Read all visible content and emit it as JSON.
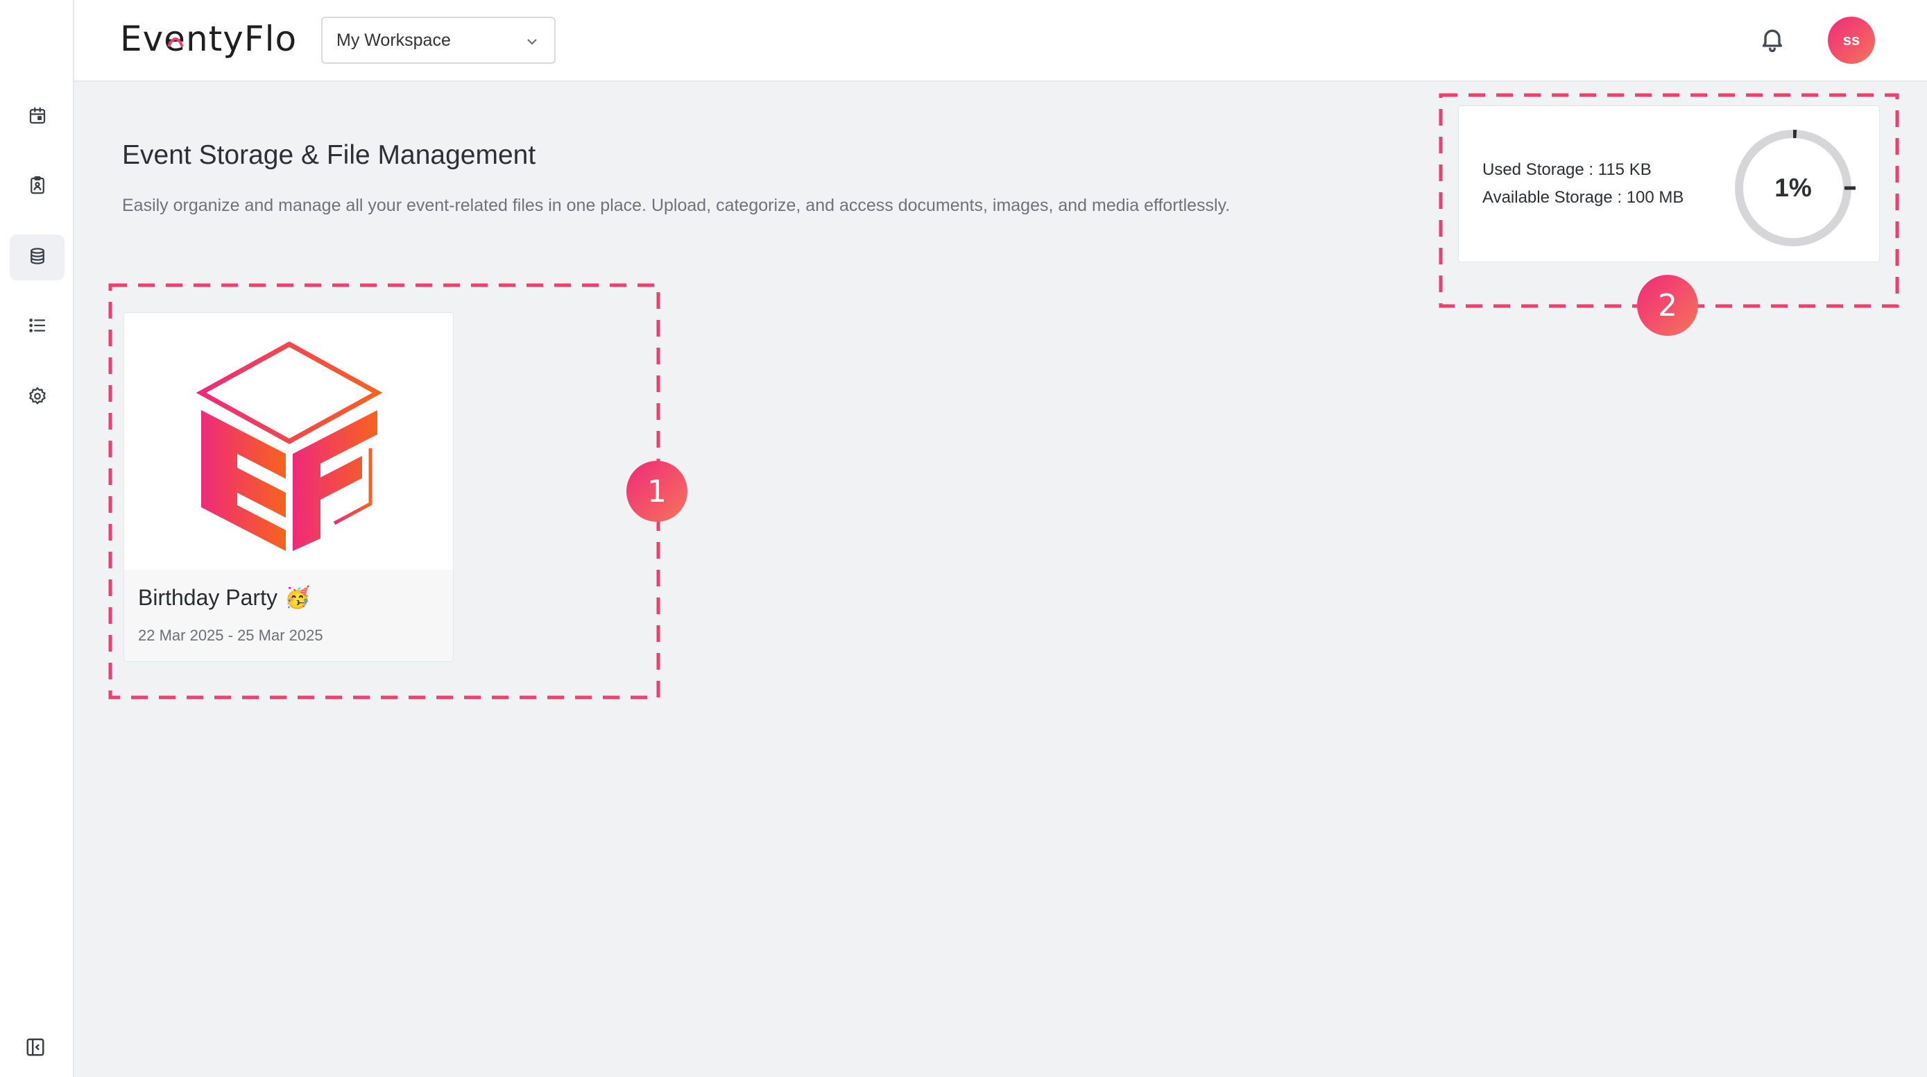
{
  "header": {
    "logo_text": "EventyFlo",
    "workspace_select": "My Workspace",
    "avatar_initials": "ss"
  },
  "sidebar": {
    "items": [
      {
        "icon": "calendar-icon"
      },
      {
        "icon": "clipboard-icon"
      },
      {
        "icon": "database-icon",
        "active": true
      },
      {
        "icon": "list-icon"
      },
      {
        "icon": "gear-icon"
      }
    ],
    "collapse_icon": "sidebar-collapse-icon"
  },
  "page": {
    "title": "Event Storage & File Management",
    "description": "Easily organize and manage all your event-related files in one place. Upload, categorize, and access documents, images, and media effortlessly."
  },
  "event": {
    "name": "Birthday Party",
    "emoji": "🥳",
    "dates": "22 Mar 2025 - 25 Mar 2025"
  },
  "storage": {
    "used": "Used Storage : 115 KB",
    "available": "Available Storage : 100 MB",
    "percent_label": "1%",
    "percent_value": 0.01
  },
  "annotations": {
    "marker_1": "1",
    "marker_2": "2"
  },
  "colors": {
    "accent_pink": "#ee2a7b",
    "accent_orange": "#f7745a",
    "background": "#f1f2f4"
  }
}
